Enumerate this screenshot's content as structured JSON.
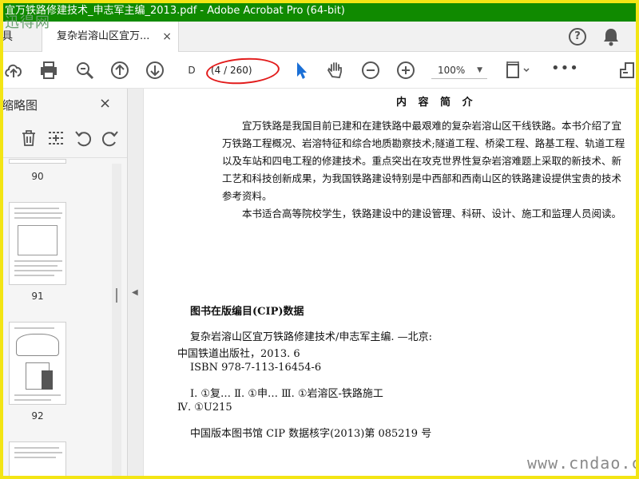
{
  "window": {
    "title": "宜万铁路修建技术_申志军主编_2013.pdf - Adobe Acrobat Pro (64-bit)"
  },
  "watermark_left": "迅得网",
  "watermark_right": "www.cndao.com",
  "tabs": {
    "tools_label": "具",
    "document_tab": "复杂岩溶山区宜万...",
    "close": "×"
  },
  "header_icons": {
    "help": "?"
  },
  "toolbar": {
    "page_input": "D",
    "page_count": "(4 / 260)",
    "zoom": "100%"
  },
  "sidebar": {
    "title": "缩略图",
    "close": "×",
    "thumbnails": [
      {
        "label": "90"
      },
      {
        "label": "91"
      },
      {
        "label": "92"
      }
    ]
  },
  "document": {
    "heading": "内 容 简 介",
    "paragraphs": [
      "宜万铁路是我国目前已建和在建铁路中最艰难的复杂岩溶山区干线铁路。本书介绍了宜万铁路工程概况、岩溶特征和综合地质勘察技术;隧道工程、桥梁工程、路基工程、轨道工程以及车站和四电工程的修建技术。重点突出在攻克世界性复杂岩溶难题上采取的新技术、新工艺和科技创新成果，为我国铁路建设特别是中西部和西南山区的铁路建设提供宝贵的技术参考资料。",
      "本书适合高等院校学生，铁路建设中的建设管理、科研、设计、施工和监理人员阅读。"
    ],
    "cip_heading": "图书在版编目(CIP)数据",
    "cip_lines": [
      "复杂岩溶山区宜万铁路修建技术/申志军主编. —北京:",
      "中国铁道出版社，2013. 6",
      "ISBN 978-7-113-16454-6",
      "Ⅰ. ①复…   Ⅱ. ①申…   Ⅲ. ①岩溶区-铁路施工",
      "Ⅳ. ①U215",
      "中国版本图书馆 CIP 数据核字(2013)第 085219 号"
    ]
  },
  "colors": {
    "titlebar": "#108a00",
    "frame": "#f3e514",
    "annotation": "#e21b1b",
    "select_tool": "#1a6fd6"
  }
}
